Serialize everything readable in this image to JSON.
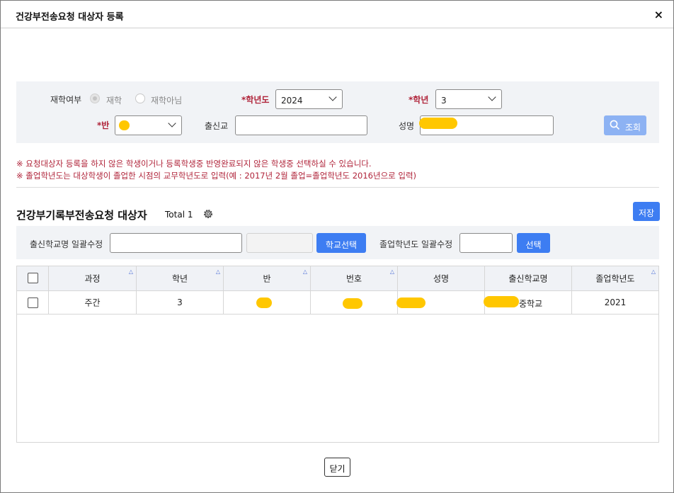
{
  "dialog": {
    "title": "건강부전송요청 대상자 등록",
    "close_glyph": "×"
  },
  "search": {
    "enroll_label": "재학여부",
    "radio_enrolled": "재학",
    "radio_not_enrolled": "재학아님",
    "year_label": "*학년도",
    "year_value": "2024",
    "grade_label": "*학년",
    "grade_value": "3",
    "class_label": "*반",
    "school_label": "출신교",
    "school_value": "",
    "name_label": "성명",
    "search_button": "조회"
  },
  "notices": [
    "※ 요청대상자 등록을 하지 않은 학생이거나 등록학생중 반영완료되지 않은 학생중 선택하실 수 있습니다.",
    "※ 졸업학년도는 대상학생이 졸업한 시점의 교무학년도로 입력(예 : 2017년 2월 졸업=졸업학년도 2016년으로 입력)"
  ],
  "section": {
    "title": "건강부기록부전송요청 대상자",
    "total_label": "Total 1",
    "save_button": "저장"
  },
  "bulk": {
    "school_label": "출신학교명 일괄수정",
    "school_select_button": "학교선택",
    "grad_year_label": "졸업학년도 일괄수정",
    "grad_select_button": "선택"
  },
  "grid": {
    "columns": [
      "과정",
      "학년",
      "반",
      "번호",
      "성명",
      "출신학교명",
      "졸업학년도"
    ],
    "rows": [
      {
        "course": "주간",
        "grade": "3",
        "class": "",
        "number": "",
        "name": "",
        "school": "중학교",
        "grad_year": "2021"
      }
    ]
  },
  "footer": {
    "close_button": "닫기"
  },
  "colors": {
    "accent": "#3d7df2",
    "required": "#b0243a",
    "redaction": "#ffc700"
  }
}
